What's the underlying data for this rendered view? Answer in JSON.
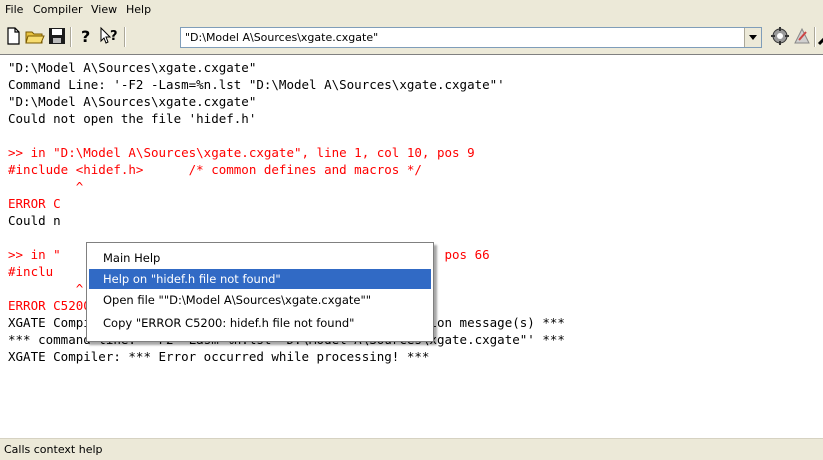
{
  "menu": [
    "File",
    "Compiler",
    "View",
    "Help"
  ],
  "toolbar": {
    "path_value": "\"D:\\Model A\\Sources\\xgate.cxgate\"",
    "icons": [
      "new-file-icon",
      "open-folder-icon",
      "save-icon",
      "help-icon",
      "context-help-icon",
      "compile-icon",
      "options-icon",
      "settings-icon"
    ]
  },
  "output": {
    "lines": [
      {
        "text": "\"D:\\Model A\\Sources\\xgate.cxgate\"",
        "color": "black"
      },
      {
        "text": "Command Line: '-F2 -Lasm=%n.lst \"D:\\Model A\\Sources\\xgate.cxgate\"'",
        "color": "black"
      },
      {
        "text": "\"D:\\Model A\\Sources\\xgate.cxgate\"",
        "color": "black"
      },
      {
        "text": "Could not open the file 'hidef.h'",
        "color": "black"
      },
      {
        "text": "",
        "color": "black"
      },
      {
        "text": ">> in \"D:\\Model A\\Sources\\xgate.cxgate\", line 1, col 10, pos 9",
        "color": "red"
      },
      {
        "text": "#include <hidef.h>      /* common defines and macros */",
        "color": "red"
      },
      {
        "text": "         ^",
        "color": "red"
      },
      {
        "text": "ERROR C",
        "color": "red"
      },
      {
        "text": "Could n",
        "color": "black"
      },
      {
        "text": "",
        "color": "black"
      },
      {
        "text": ">> in \"                                 , line 2, col 10, pos 66",
        "color": "red"
      },
      {
        "text": "#inclu",
        "color": "red"
      },
      {
        "text": "         ^",
        "color": "red"
      },
      {
        "text": "ERROR C5200: xgate.h file not found",
        "color": "red"
      },
      {
        "text": "XGATE Compiler: *** 2 error(s), 0 warning(s), 0 information message(s) ***",
        "color": "black"
      },
      {
        "text": "*** command line: '-F2 -Lasm=%n.lst \"D:\\Model A\\Sources\\xgate.cxgate\"' ***",
        "color": "black"
      },
      {
        "text": "XGATE Compiler: *** Error occurred while processing! ***",
        "color": "black"
      }
    ]
  },
  "context_menu": {
    "items": [
      {
        "label": "Main Help",
        "selected": false
      },
      {
        "label": "Help on \"hidef.h file not found\"",
        "selected": true
      },
      {
        "label": "Open file \"\"D:\\Model A\\Sources\\xgate.cxgate\"\"",
        "selected": false
      },
      {
        "label": "Copy \"ERROR C5200: hidef.h file not found\"",
        "selected": false
      }
    ]
  },
  "status": "Calls context help",
  "colors": {
    "error": "#ff0000",
    "selection": "#316ac5",
    "chrome": "#ece9d8"
  }
}
